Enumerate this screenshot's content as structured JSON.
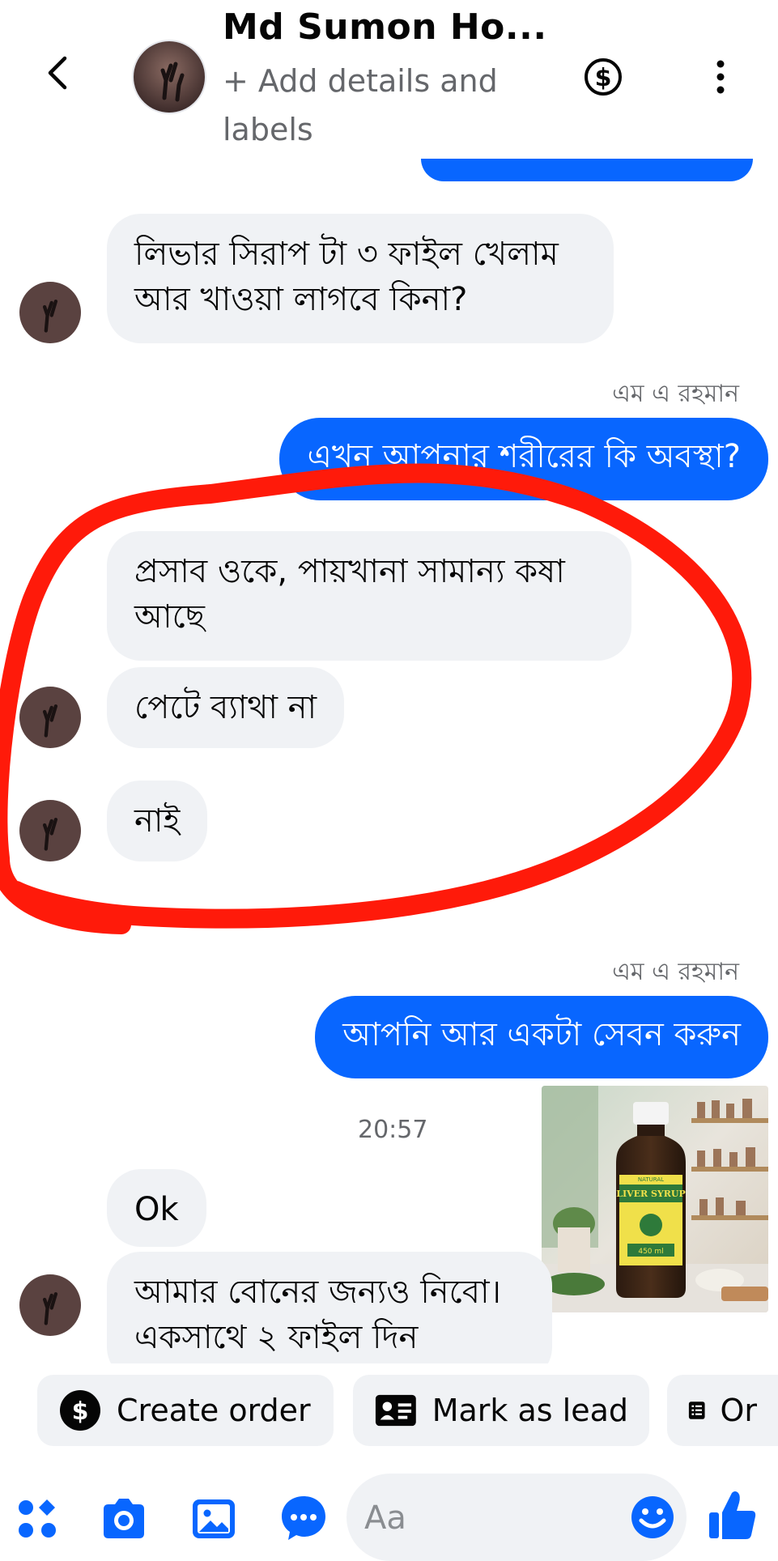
{
  "header": {
    "contact_name": "Md Sumon Ho...",
    "subtitle": "+ Add details and labels"
  },
  "messages": {
    "m1": "লিভার সিরাপ টা ৩ ফাইল খেলাম আর খাওয়া লাগবে কিনা?",
    "sender1": "এম এ রহমান",
    "m2": "এখন আপনার শরীরের কি অবস্থা?",
    "m3": "প্রসাব ওকে, পায়খানা সামান্য কষা আছে",
    "m4": "পেটে ব্যাথা না",
    "m5": "নাই",
    "sender2": "এম এ রহমান",
    "m6": "আপনি আর একটা সেবন করুন",
    "timestamp": "20:57",
    "m7": "Ok",
    "m8": "আমার বোনের জন্যও নিবো। একসাথে ২ ফাইল দিন"
  },
  "product_image": {
    "label_top": "NATURAL",
    "label_main": "LIVER SYRUP",
    "label_volume": "450 ml"
  },
  "quick_actions": {
    "create_order": "Create order",
    "mark_lead": "Mark as lead",
    "third": "Or"
  },
  "composer": {
    "placeholder": "Aa"
  },
  "colors": {
    "accent": "#0866ff",
    "incoming_bubble": "#f0f2f5",
    "annotation_circle": "#ff1a0a"
  }
}
